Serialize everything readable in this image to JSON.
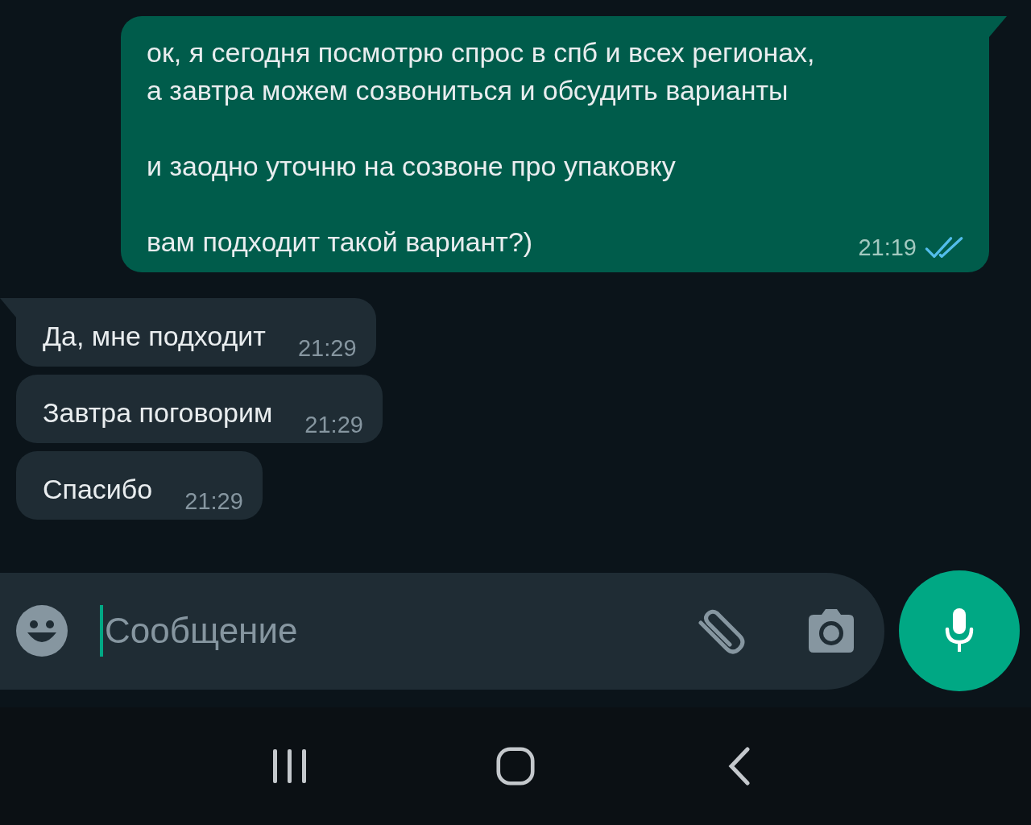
{
  "messages": [
    {
      "kind": "outgoing",
      "paragraphs": [
        "ок, я сегодня посмотрю спрос в спб и всех регионах,\nа завтра можем созвониться и обсудить варианты",
        "и заодно уточню на созвоне про упаковку",
        "вам подходит такой вариант?)"
      ],
      "time": "21:19",
      "read": true,
      "tail": true
    },
    {
      "kind": "incoming",
      "paragraphs": [
        "Да, мне подходит"
      ],
      "time": "21:29",
      "tail": true
    },
    {
      "kind": "incoming",
      "paragraphs": [
        "Завтра поговорим"
      ],
      "time": "21:29",
      "tail": false
    },
    {
      "kind": "incoming",
      "paragraphs": [
        "Спасибо"
      ],
      "time": "21:29",
      "tail": false
    }
  ],
  "composer": {
    "placeholder": "Сообщение"
  }
}
